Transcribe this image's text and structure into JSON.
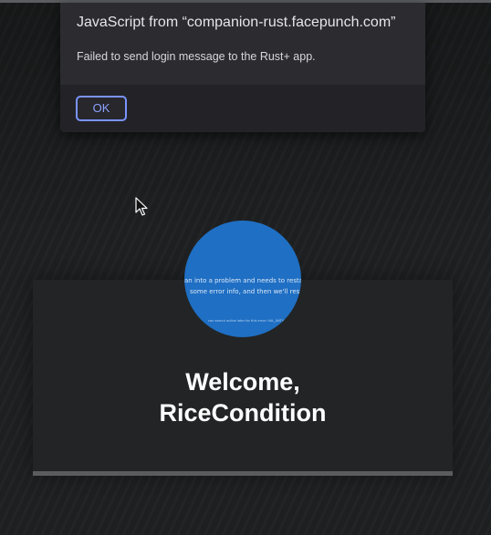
{
  "dialog": {
    "title": "JavaScript from “companion-rust.facepunch.com”",
    "message": "Failed to send login message to the Rust+ app.",
    "ok_label": "OK"
  },
  "avatar": {
    "line1": "an into a problem and needs to restart.",
    "line2": "some error info, and then we'll restart",
    "line3": "can search online later for this error: HAL_INITIAL"
  },
  "welcome": {
    "line1": "Welcome,",
    "line2": "RiceCondition"
  },
  "colors": {
    "accent": "#7a93ff",
    "avatar_bg": "#1f6fc4",
    "background": "#1d1f20"
  }
}
